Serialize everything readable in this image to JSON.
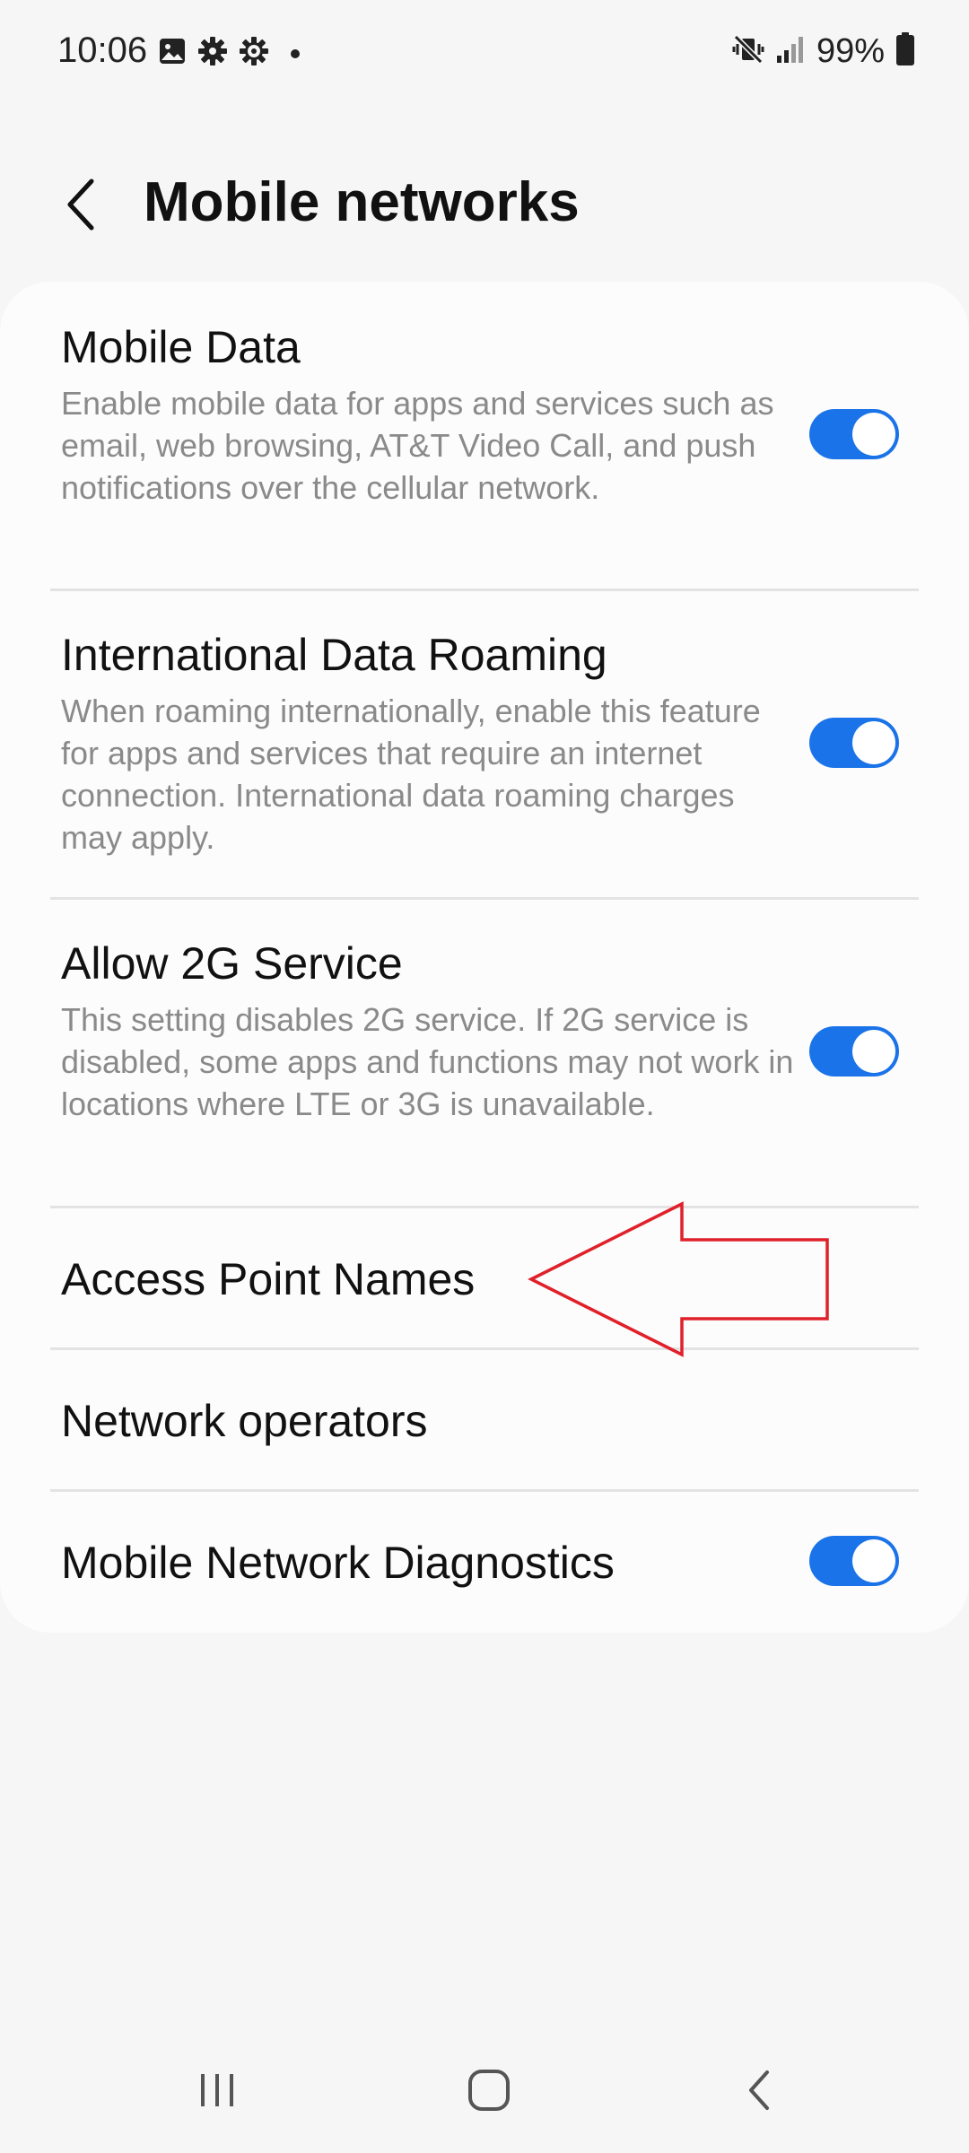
{
  "status_bar": {
    "time": "10:06",
    "battery": "99%",
    "icons_left": [
      "image-icon",
      "settings-icon",
      "settings-outline-icon",
      "dot-icon"
    ],
    "icons_right": [
      "vibrate-mute-icon",
      "signal-icon",
      "battery-icon"
    ]
  },
  "header": {
    "title": "Mobile networks",
    "back_icon": "chevron-left-icon"
  },
  "settings": {
    "mobile_data": {
      "title": "Mobile Data",
      "desc": "Enable mobile data for apps and services such as email, web browsing, AT&T Video Call, and push notifications over the cellular network.",
      "enabled": true
    },
    "roaming": {
      "title": "International Data Roaming",
      "desc": "When roaming internationally, enable this feature for apps and services that require an internet connection. International data roaming charges may apply.",
      "enabled": true
    },
    "allow_2g": {
      "title": "Allow 2G Service",
      "desc": "This setting disables 2G service. If 2G service is disabled, some apps and functions may not work in locations where LTE or 3G is unavailable.",
      "enabled": true
    },
    "apn": {
      "title": "Access Point Names"
    },
    "operators": {
      "title": "Network operators"
    },
    "diagnostics": {
      "title": "Mobile Network Diagnostics",
      "enabled": true
    }
  },
  "colors": {
    "accent": "#1a73e8",
    "annotation": "#e0202a",
    "background": "#f6f6f6",
    "card": "#fcfcfc"
  },
  "nav_bar": {
    "icons": [
      "recent-apps-icon",
      "home-icon",
      "back-icon"
    ]
  }
}
